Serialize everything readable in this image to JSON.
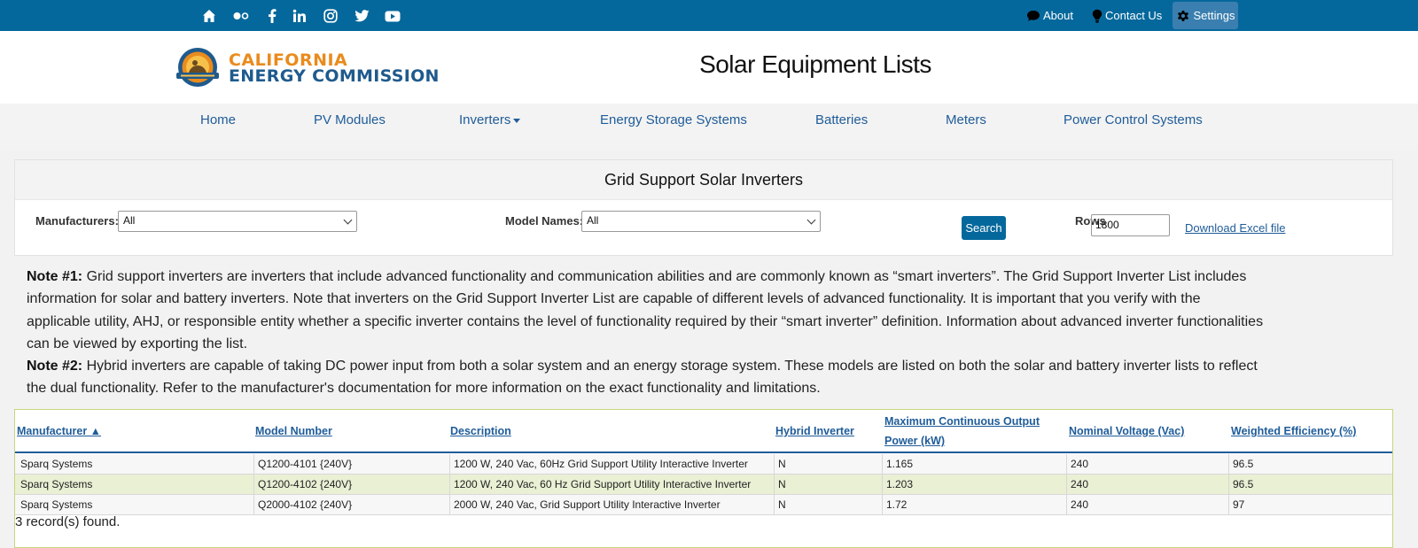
{
  "topbar": {
    "social_icons": [
      "home-icon",
      "flickr-icon",
      "facebook-icon",
      "linkedin-icon",
      "instagram-icon",
      "twitter-icon",
      "youtube-icon"
    ],
    "links": {
      "about": "About",
      "contact": "Contact Us",
      "settings": "Settings"
    }
  },
  "header": {
    "logo_line1": "CALIFORNIA",
    "logo_line2": "ENERGY COMMISSION",
    "title": "Solar Equipment Lists"
  },
  "nav": {
    "items": [
      "Home",
      "PV Modules",
      "Inverters",
      "Energy Storage Systems",
      "Batteries",
      "Meters",
      "Power Control Systems"
    ]
  },
  "filters": {
    "heading": "Grid Support Solar Inverters",
    "manufacturers_label": "Manufacturers:",
    "manufacturers_value": "All",
    "models_label": "Model Names:",
    "models_value": "All",
    "search_label": "Search",
    "rows_label": "Rows",
    "rows_value": "1800",
    "download_label": "Download Excel file"
  },
  "notes": {
    "note1_label": "Note #1:",
    "note1_text": " Grid support inverters are inverters that include advanced functionality and communication abilities and are commonly known as “smart inverters”. The Grid Support Inverter List includes information for solar and battery inverters. Note that inverters on the Grid Support Inverter List are capable of different levels of advanced functionality. It is important that you verify with the applicable utility, AHJ, or responsible entity whether a specific inverter contains the level of functionality required by their “smart inverter” definition. Information about advanced inverter functionalities can be viewed by exporting the list.",
    "note2_label": "Note #2:",
    "note2_text": " Hybrid inverters are capable of taking DC power input from both a solar system and an energy storage system. These models are listed on both the solar and battery inverter lists to reflect the dual functionality. Refer to the manufacturer's documentation for more information on the exact functionality and limitations."
  },
  "table": {
    "headers": {
      "manufacturer": "Manufacturer ▲",
      "model": "Model Number",
      "description": "Description",
      "hybrid": "Hybrid Inverter",
      "max_power_1": "Maximum Continuous Output",
      "max_power_2": "Power (kW)",
      "voltage": "Nominal Voltage (Vac)",
      "efficiency": "Weighted Efficiency (%)"
    },
    "rows": [
      {
        "manufacturer": "Sparq Systems",
        "model": "Q1200-4101 {240V}",
        "description": "1200 W, 240 Vac, 60Hz Grid Support Utility Interactive Inverter",
        "hybrid": "N",
        "power": "1.165",
        "voltage": "240",
        "efficiency": "96.5"
      },
      {
        "manufacturer": "Sparq Systems",
        "model": "Q1200-4102 {240V}",
        "description": "1200 W, 240 Vac, 60 Hz Grid Support Utility Interactive Inverter",
        "hybrid": "N",
        "power": "1.203",
        "voltage": "240",
        "efficiency": "96.5"
      },
      {
        "manufacturer": "Sparq Systems",
        "model": "Q2000-4102 {240V}",
        "description": "2000 W, 240 Vac, Grid Support Utility Interactive Inverter",
        "hybrid": "N",
        "power": "1.72",
        "voltage": "240",
        "efficiency": "97"
      }
    ],
    "records_found": "3 record(s) found."
  }
}
